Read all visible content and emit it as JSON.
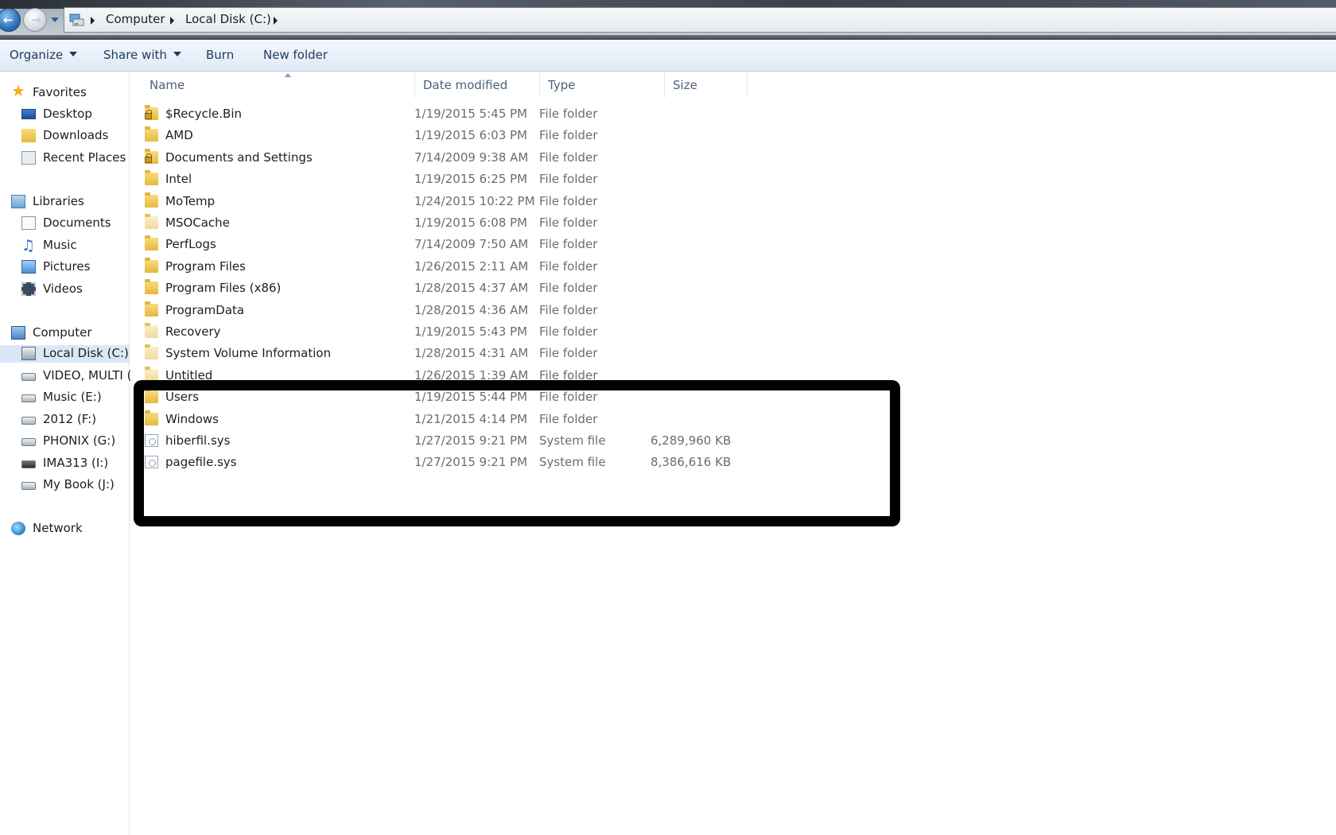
{
  "address": {
    "breadcrumbs": [
      "Computer",
      "Local Disk (C:)"
    ]
  },
  "toolbar": {
    "organize": "Organize",
    "share_with": "Share with",
    "burn": "Burn",
    "new_folder": "New folder"
  },
  "nav": {
    "favorites": {
      "header": "Favorites",
      "items": [
        "Desktop",
        "Downloads",
        "Recent Places"
      ]
    },
    "libraries": {
      "header": "Libraries",
      "items": [
        "Documents",
        "Music",
        "Pictures",
        "Videos"
      ]
    },
    "computer": {
      "header": "Computer",
      "items": [
        "Local Disk (C:)",
        "VIDEO, MULTI (",
        "Music (E:)",
        "2012 (F:)",
        "PHONIX (G:)",
        "IMA313 (I:)",
        "My Book (J:)"
      ]
    },
    "network": {
      "header": "Network"
    }
  },
  "columns": {
    "name": "Name",
    "date": "Date modified",
    "type": "Type",
    "size": "Size"
  },
  "files": [
    {
      "name": "$Recycle.Bin",
      "date": "1/19/2015 5:45 PM",
      "type": "File folder",
      "size": "",
      "icon": "folder-locked-icon"
    },
    {
      "name": "AMD",
      "date": "1/19/2015 6:03 PM",
      "type": "File folder",
      "size": "",
      "icon": "folder-icon"
    },
    {
      "name": "Documents and Settings",
      "date": "7/14/2009 9:38 AM",
      "type": "File folder",
      "size": "",
      "icon": "folder-locked-icon"
    },
    {
      "name": "Intel",
      "date": "1/19/2015 6:25 PM",
      "type": "File folder",
      "size": "",
      "icon": "folder-icon"
    },
    {
      "name": "MoTemp",
      "date": "1/24/2015 10:22 PM",
      "type": "File folder",
      "size": "",
      "icon": "folder-icon"
    },
    {
      "name": "MSOCache",
      "date": "1/19/2015 6:08 PM",
      "type": "File folder",
      "size": "",
      "icon": "folder-icon"
    },
    {
      "name": "PerfLogs",
      "date": "7/14/2009 7:50 AM",
      "type": "File folder",
      "size": "",
      "icon": "folder-icon"
    },
    {
      "name": "Program Files",
      "date": "1/26/2015 2:11 AM",
      "type": "File folder",
      "size": "",
      "icon": "folder-icon"
    },
    {
      "name": "Program Files (x86)",
      "date": "1/28/2015 4:37 AM",
      "type": "File folder",
      "size": "",
      "icon": "folder-icon"
    },
    {
      "name": "ProgramData",
      "date": "1/28/2015 4:36 AM",
      "type": "File folder",
      "size": "",
      "icon": "folder-icon"
    },
    {
      "name": "Recovery",
      "date": "1/19/2015 5:43 PM",
      "type": "File folder",
      "size": "",
      "icon": "folder-icon"
    },
    {
      "name": "System Volume Information",
      "date": "1/28/2015 4:31 AM",
      "type": "File folder",
      "size": "",
      "icon": "folder-icon"
    },
    {
      "name": "Untitled",
      "date": "1/26/2015 1:39 AM",
      "type": "File folder",
      "size": "",
      "icon": "folder-icon"
    },
    {
      "name": "Users",
      "date": "1/19/2015 5:44 PM",
      "type": "File folder",
      "size": "",
      "icon": "folder-icon"
    },
    {
      "name": "Windows",
      "date": "1/21/2015 4:14 PM",
      "type": "File folder",
      "size": "",
      "icon": "folder-icon"
    },
    {
      "name": "hiberfil.sys",
      "date": "1/27/2015 9:21 PM",
      "type": "System file",
      "size": "6,289,960 KB",
      "icon": "system-file-icon"
    },
    {
      "name": "pagefile.sys",
      "date": "1/27/2015 9:21 PM",
      "type": "System file",
      "size": "8,386,616 KB",
      "icon": "system-file-icon"
    }
  ]
}
